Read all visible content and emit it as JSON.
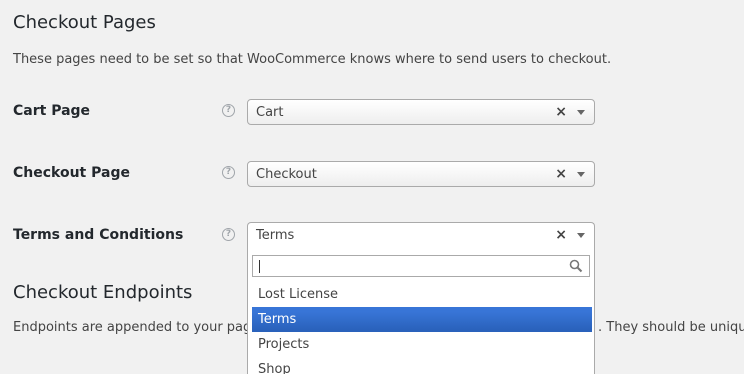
{
  "checkout_pages": {
    "title": "Checkout Pages",
    "description": "These pages need to be set so that WooCommerce knows where to send users to checkout."
  },
  "rows": [
    {
      "label": "Cart Page",
      "value": "Cart",
      "help_icon": "question-circle-icon"
    },
    {
      "label": "Checkout Page",
      "value": "Checkout",
      "help_icon": "question-circle-icon"
    },
    {
      "label": "Terms and Conditions",
      "value": "Terms",
      "help_icon": "question-circle-icon"
    }
  ],
  "dropdown": {
    "search_value": "",
    "options": [
      "Lost License",
      "Terms",
      "Projects",
      "Shop"
    ],
    "highlighted": "Terms"
  },
  "checkout_endpoints": {
    "title": "Checkout Endpoints",
    "description_left": "Endpoints are appended to your page U",
    "description_right": ". They should be unique."
  },
  "help_glyph": "?",
  "clear_glyph": "×",
  "colors": {
    "highlight": "#3875d7",
    "background": "#f1f1f1"
  }
}
